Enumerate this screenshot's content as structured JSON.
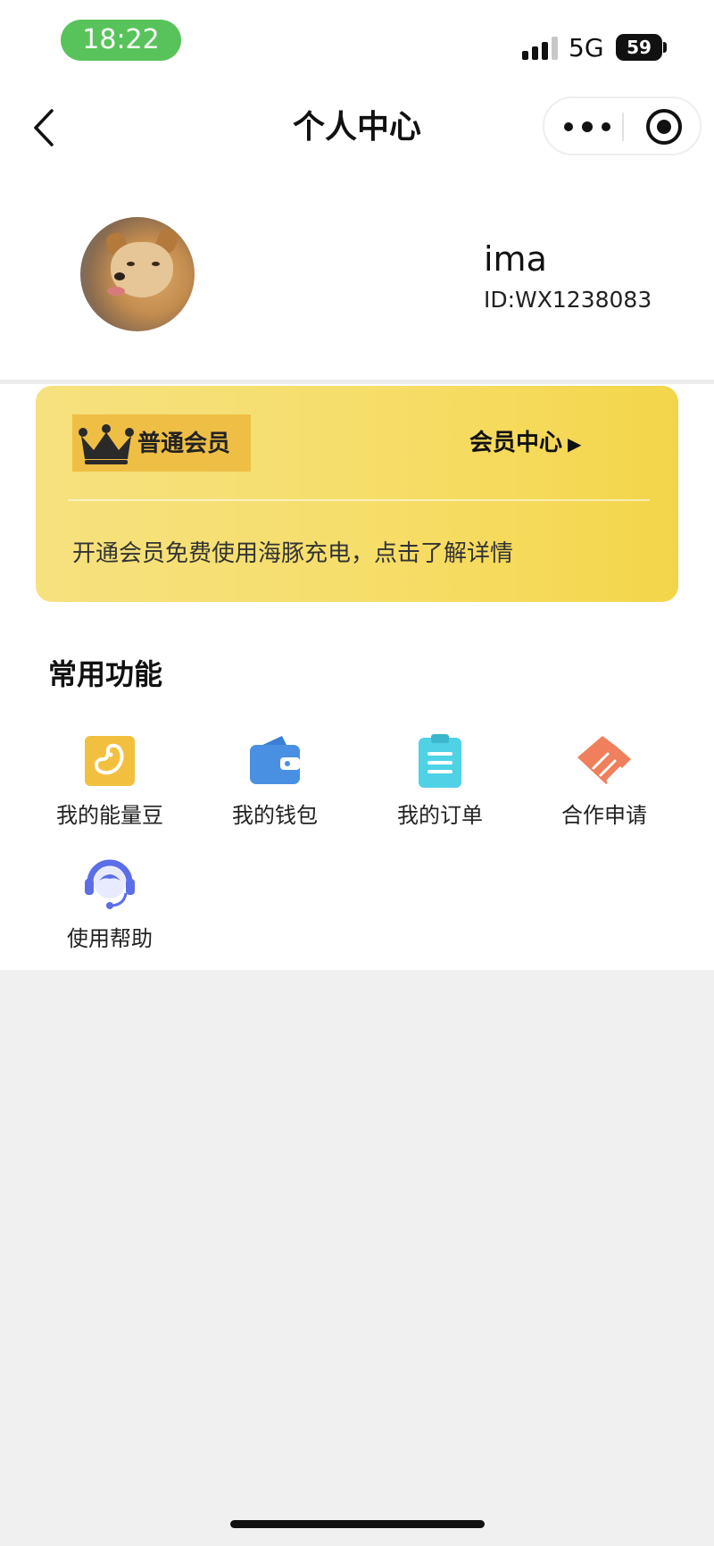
{
  "status_bar": {
    "time": "18:22",
    "network": "5G",
    "battery": "59"
  },
  "nav": {
    "title": "个人中心"
  },
  "profile": {
    "name": "ima",
    "id": "ID:WX1238083"
  },
  "member_card": {
    "level": "普通会员",
    "center_link": "会员中心",
    "center_arrow": "▶",
    "description": "开通会员免费使用海豚充电，点击了解详情"
  },
  "functions": {
    "title": "常用功能",
    "items": [
      {
        "label": "我的能量豆",
        "icon": "energy-bean-icon",
        "color": "#f2c03e"
      },
      {
        "label": "我的钱包",
        "icon": "wallet-icon",
        "color": "#4a90e2"
      },
      {
        "label": "我的订单",
        "icon": "order-clipboard-icon",
        "color": "#4fd1e6"
      },
      {
        "label": "合作申请",
        "icon": "handshake-icon",
        "color": "#f07f5d"
      },
      {
        "label": "使用帮助",
        "icon": "customer-service-icon",
        "color": "#5b6ee8"
      }
    ]
  }
}
